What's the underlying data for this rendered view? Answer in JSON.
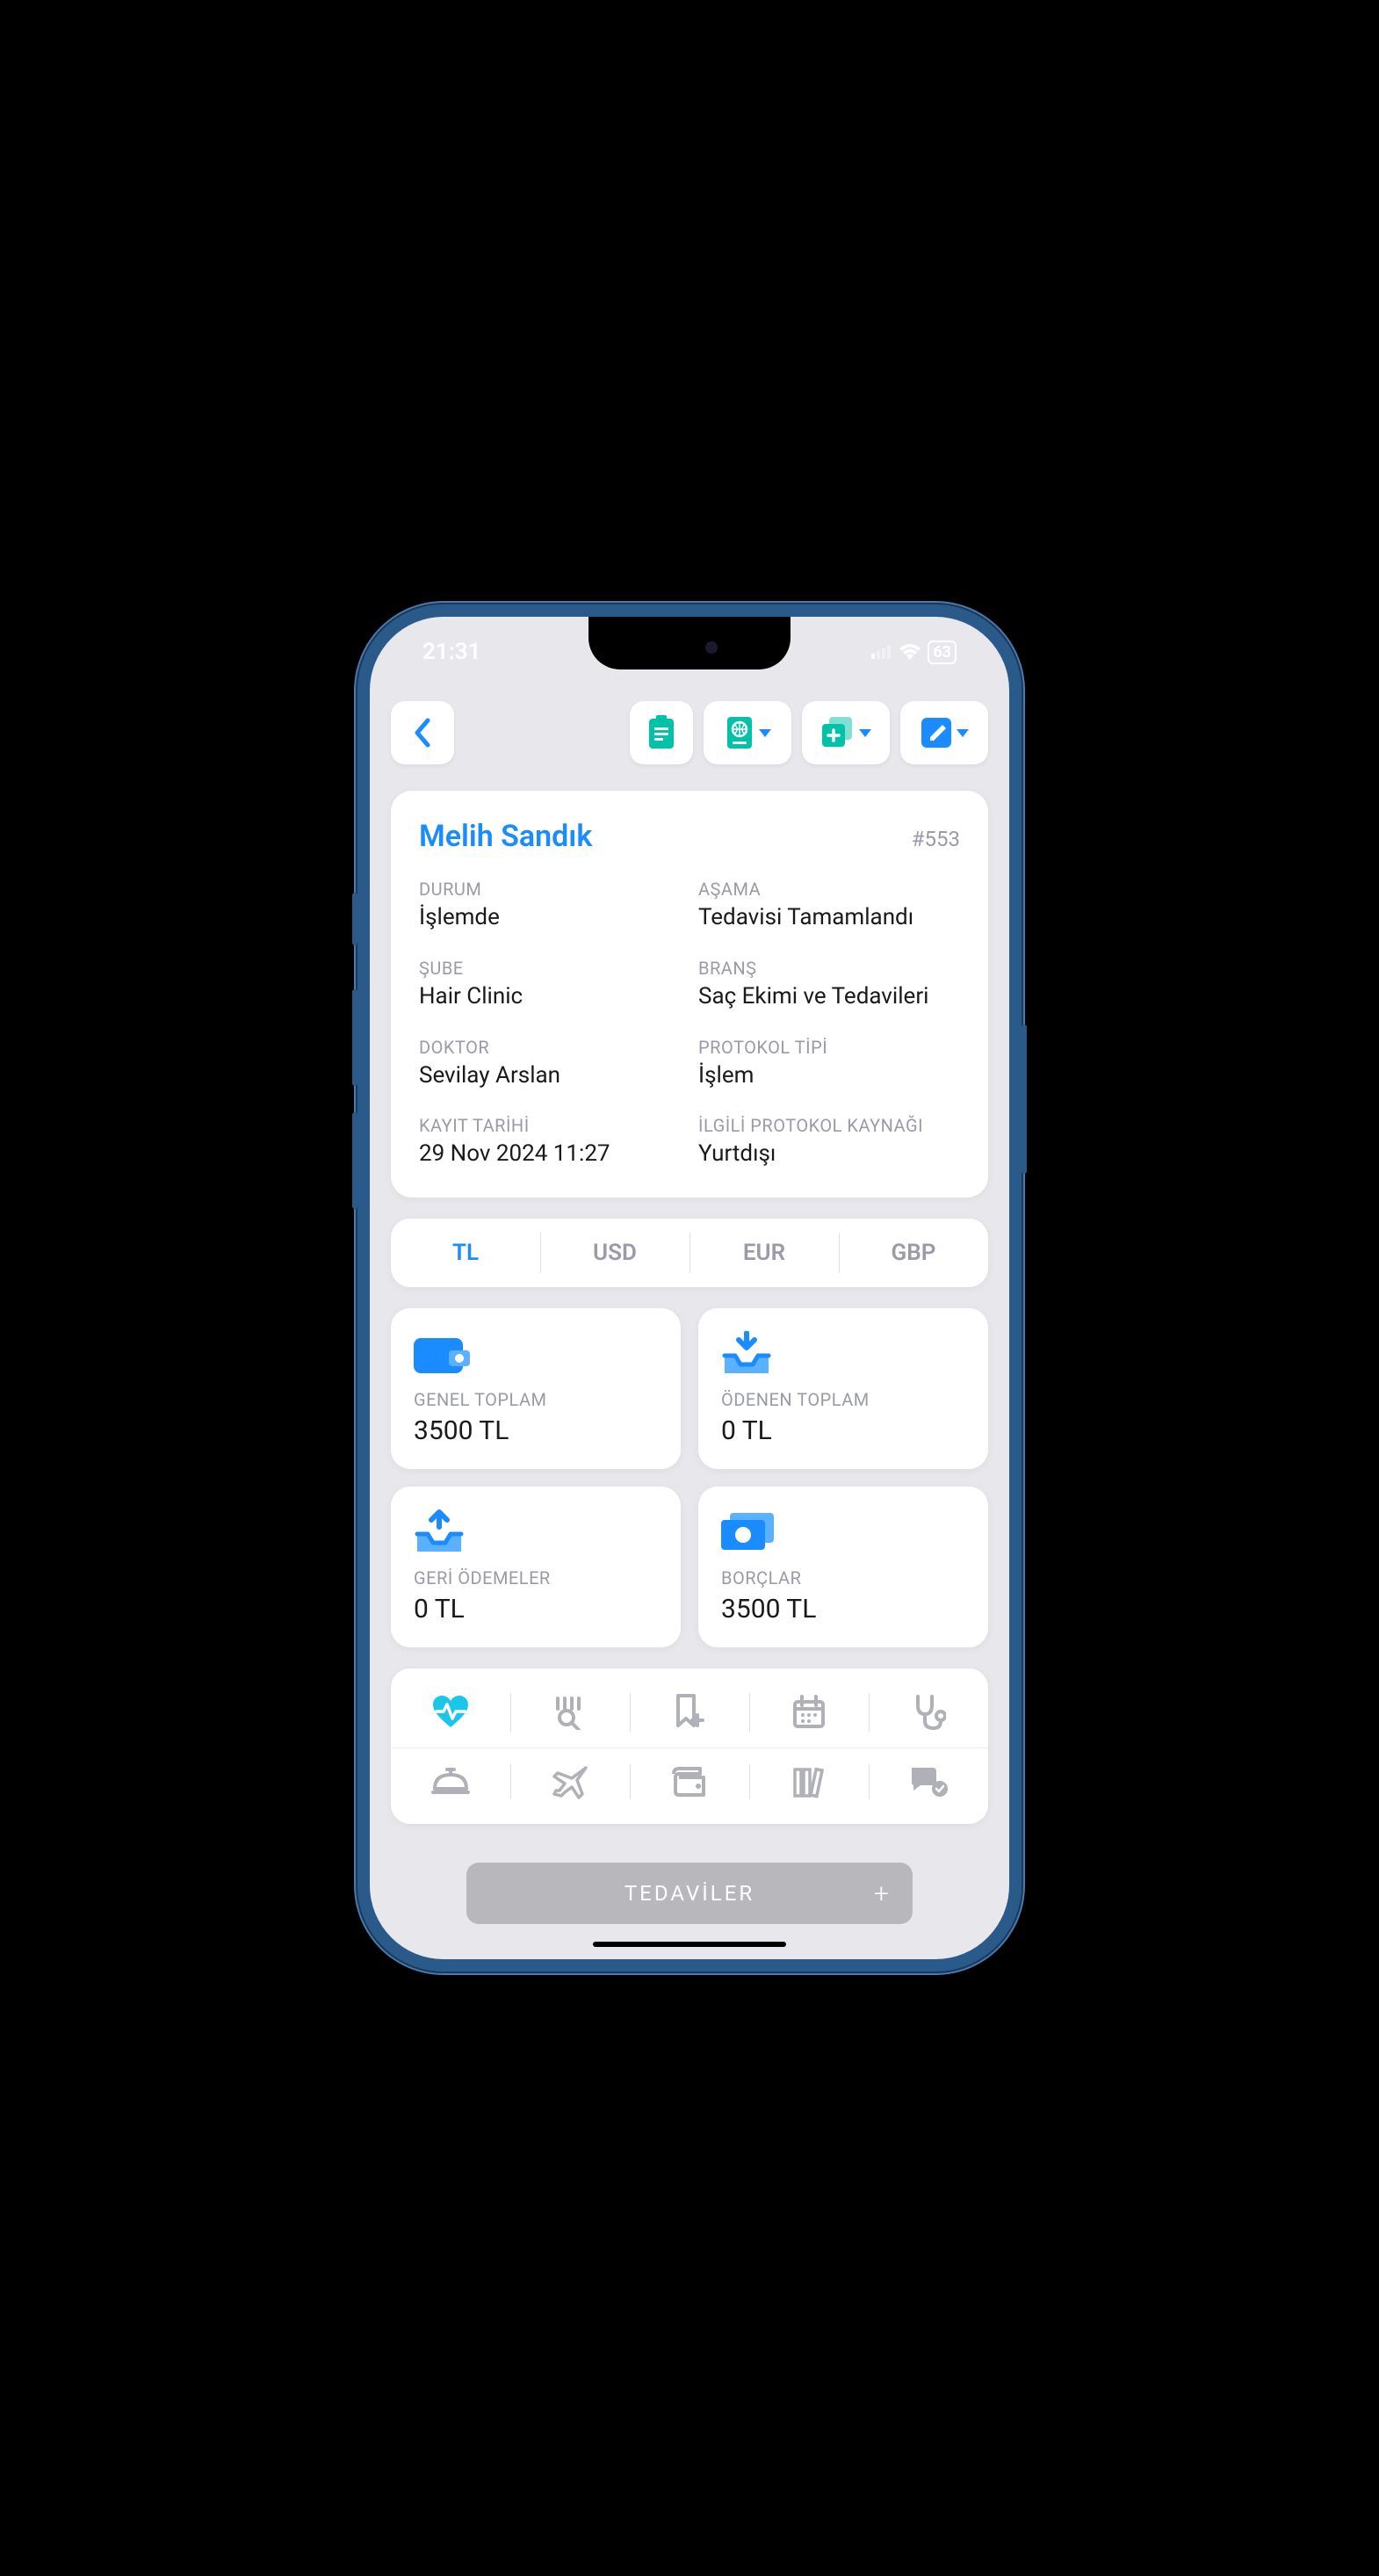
{
  "status": {
    "time": "21:31",
    "battery": "63"
  },
  "patient": {
    "name": "Melih Sandık",
    "id": "#553",
    "fields": {
      "durum": {
        "label": "DURUM",
        "value": "İşlemde"
      },
      "asama": {
        "label": "AŞAMA",
        "value": "Tedavisi Tamamlandı"
      },
      "sube": {
        "label": "ŞUBE",
        "value": "Hair Clinic"
      },
      "brans": {
        "label": "BRANŞ",
        "value": "Saç Ekimi ve Tedavileri"
      },
      "doktor": {
        "label": "DOKTOR",
        "value": "Sevilay Arslan"
      },
      "protokol": {
        "label": "PROTOKOL TİPİ",
        "value": "İşlem"
      },
      "kayit": {
        "label": "KAYIT TARİHİ",
        "value": "29 Nov 2024 11:27"
      },
      "kaynak": {
        "label": "İLGİLİ PROTOKOL KAYNAĞI",
        "value": "Yurtdışı"
      }
    }
  },
  "currency": {
    "active": "TL",
    "tabs": {
      "tl": "TL",
      "usd": "USD",
      "eur": "EUR",
      "gbp": "GBP"
    }
  },
  "stats": {
    "genel": {
      "label": "GENEL TOPLAM",
      "value": "3500 TL"
    },
    "odenen": {
      "label": "ÖDENEN TOPLAM",
      "value": "0 TL"
    },
    "geri": {
      "label": "GERİ ÖDEMELER",
      "value": "0 TL"
    },
    "borc": {
      "label": "BORÇLAR",
      "value": "3500 TL"
    }
  },
  "bottom": {
    "label": "TEDAVİLER",
    "plus": "+"
  },
  "colors": {
    "accent": "#1a8cff",
    "teal": "#00c2a8",
    "muted": "#9a9aa8"
  }
}
